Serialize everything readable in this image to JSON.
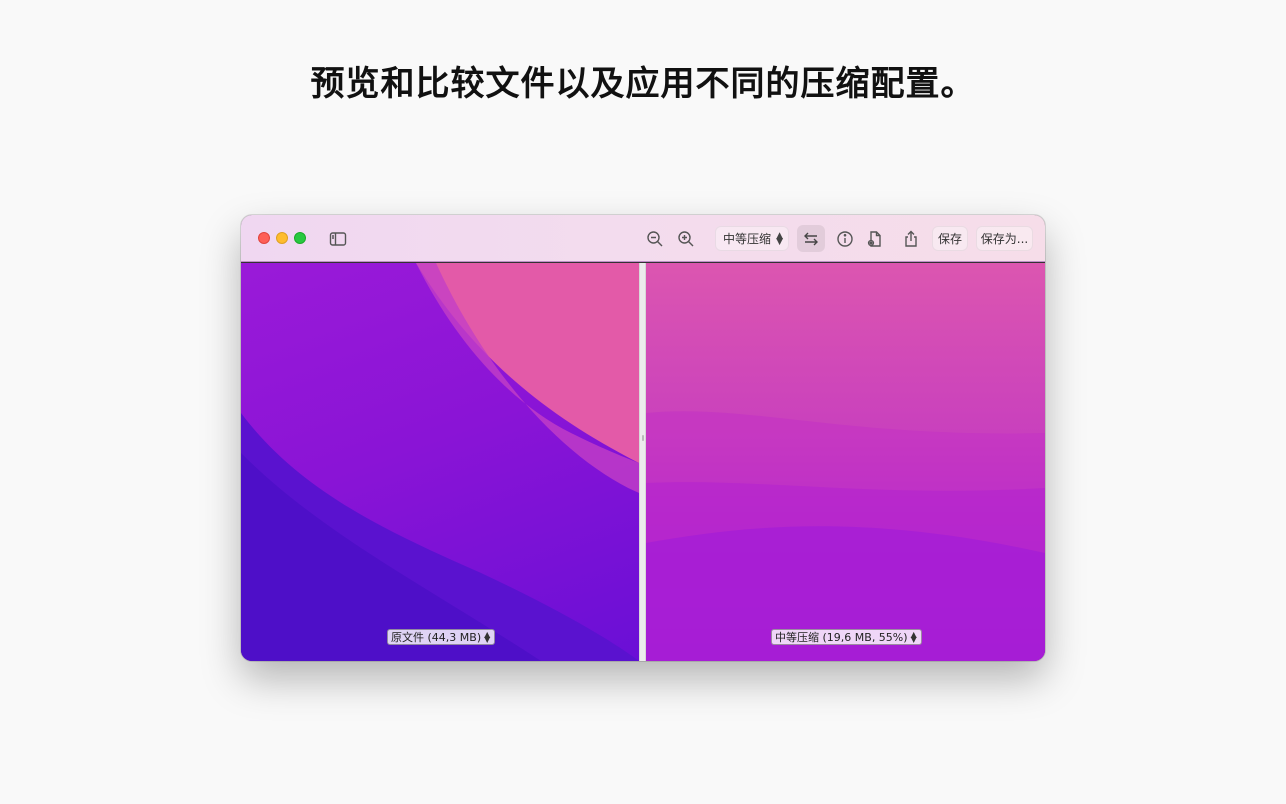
{
  "headline": "预览和比较文件以及应用不同的压缩配置。",
  "window": {
    "toolbar": {
      "preset": "中等压缩",
      "save_label": "保存",
      "save_as_label": "保存为..."
    },
    "left_pane": {
      "label": "原文件 (44,3 MB)"
    },
    "right_pane": {
      "label": "中等压缩 (19,6 MB, 55%)"
    }
  },
  "icons": {
    "sidebar_toggle": "sidebar-icon",
    "zoom_out": "zoom-out-icon",
    "zoom_in": "zoom-in-icon",
    "swap": "swap-icon",
    "info": "info-icon",
    "document_settings": "document-gear-icon",
    "share": "share-icon"
  },
  "colors": {
    "close": "#fe5f57",
    "minimize": "#febc2e",
    "maximize": "#28c840"
  }
}
